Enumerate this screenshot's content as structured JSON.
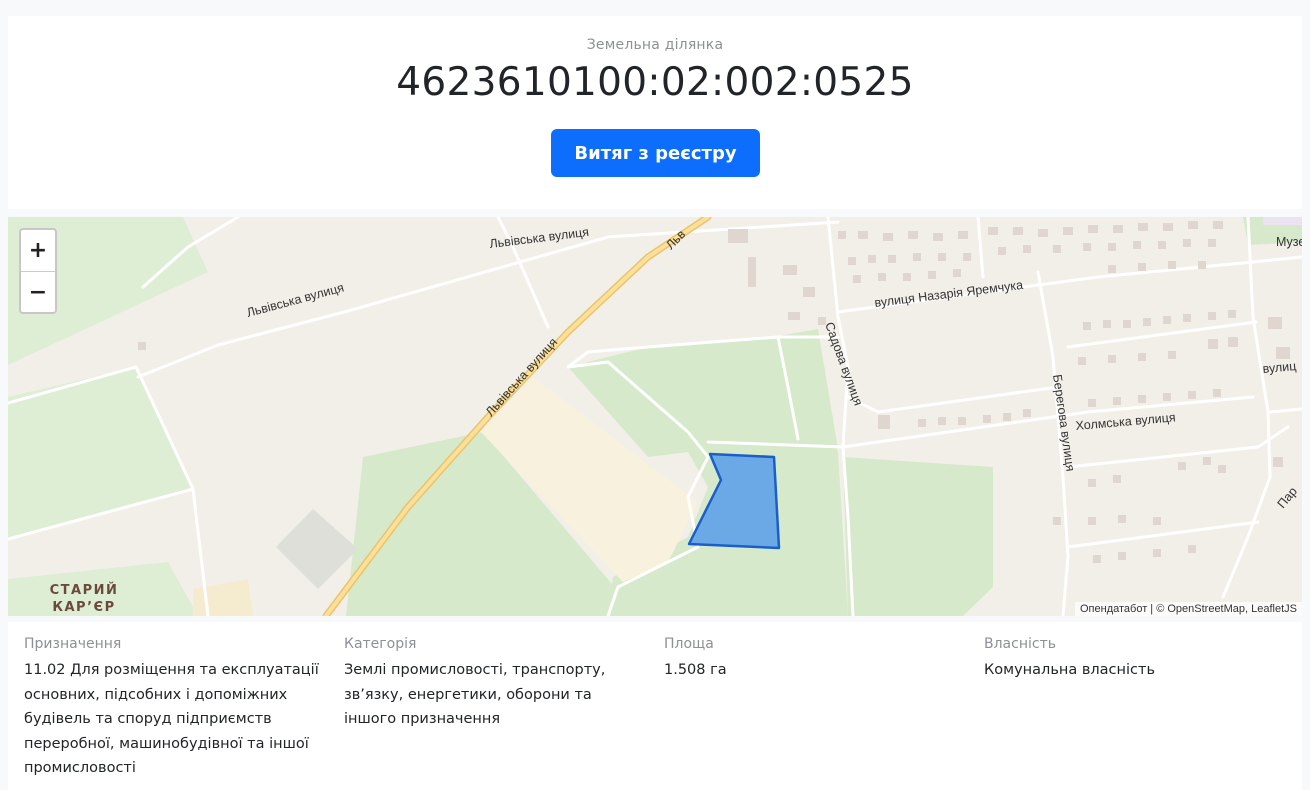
{
  "header": {
    "subtitle": "Земельна ділянка",
    "cadastral_number": "4623610100:02:002:0525",
    "extract_button_label": "Витяг з реєстру",
    "button_color": "#0d6efd"
  },
  "map": {
    "zoom_in_label": "+",
    "zoom_out_label": "−",
    "attribution": "Опендатабот | © OpenStreetMap, LeafletJS",
    "parcel_color": "#6aa9e6",
    "labels": {
      "lvivska_1": "Львівська вулиця",
      "lvivska_2": "Львівська вулиця",
      "lvivska_3": "Львівська вулиця",
      "lvivska_4": "Льв",
      "yaremchuka": "вулиця Назарія Яремчука",
      "sadova": "Садова вулиця",
      "beregova": "Берегова вулиця",
      "kholmska": "Холмська вулиця",
      "muz": "Музе",
      "vulytsia": "вулиц",
      "par": "Пар",
      "staryi": "СТАРИЙ",
      "karier": "КАР’ЄР"
    }
  },
  "details": {
    "purpose_label": "Призначення",
    "purpose_value": "11.02 Для розміщення та експлуатації основних, підсобних і допоміжних будівель та споруд підприємств переробної, машинобудівної та іншої промисловості",
    "category_label": "Категорія",
    "category_value": "Землі промисловості, транспорту, зв’язку, енергетики, оборони та іншого призначення",
    "area_label": "Площа",
    "area_value": "1.508 га",
    "ownership_label": "Власність",
    "ownership_value": "Комунальна власність"
  }
}
